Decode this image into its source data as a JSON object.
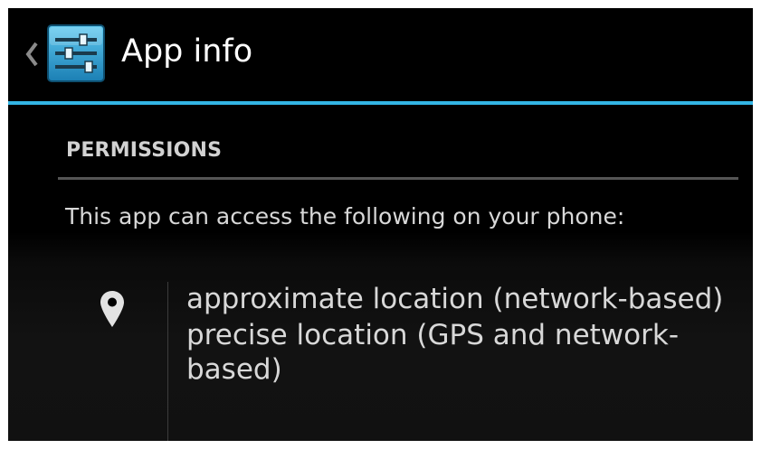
{
  "action_bar": {
    "title": "App info",
    "up_icon": "chevron-left-icon",
    "app_icon": "settings-sliders-icon",
    "accent_color": "#33b5e5"
  },
  "permissions": {
    "header": "PERMISSIONS",
    "intro": "This app can access the following on your phone:",
    "groups": [
      {
        "icon": "location-pin-icon",
        "items": [
          "approximate location (network-based)",
          "precise location (GPS and network-based)"
        ]
      }
    ]
  }
}
